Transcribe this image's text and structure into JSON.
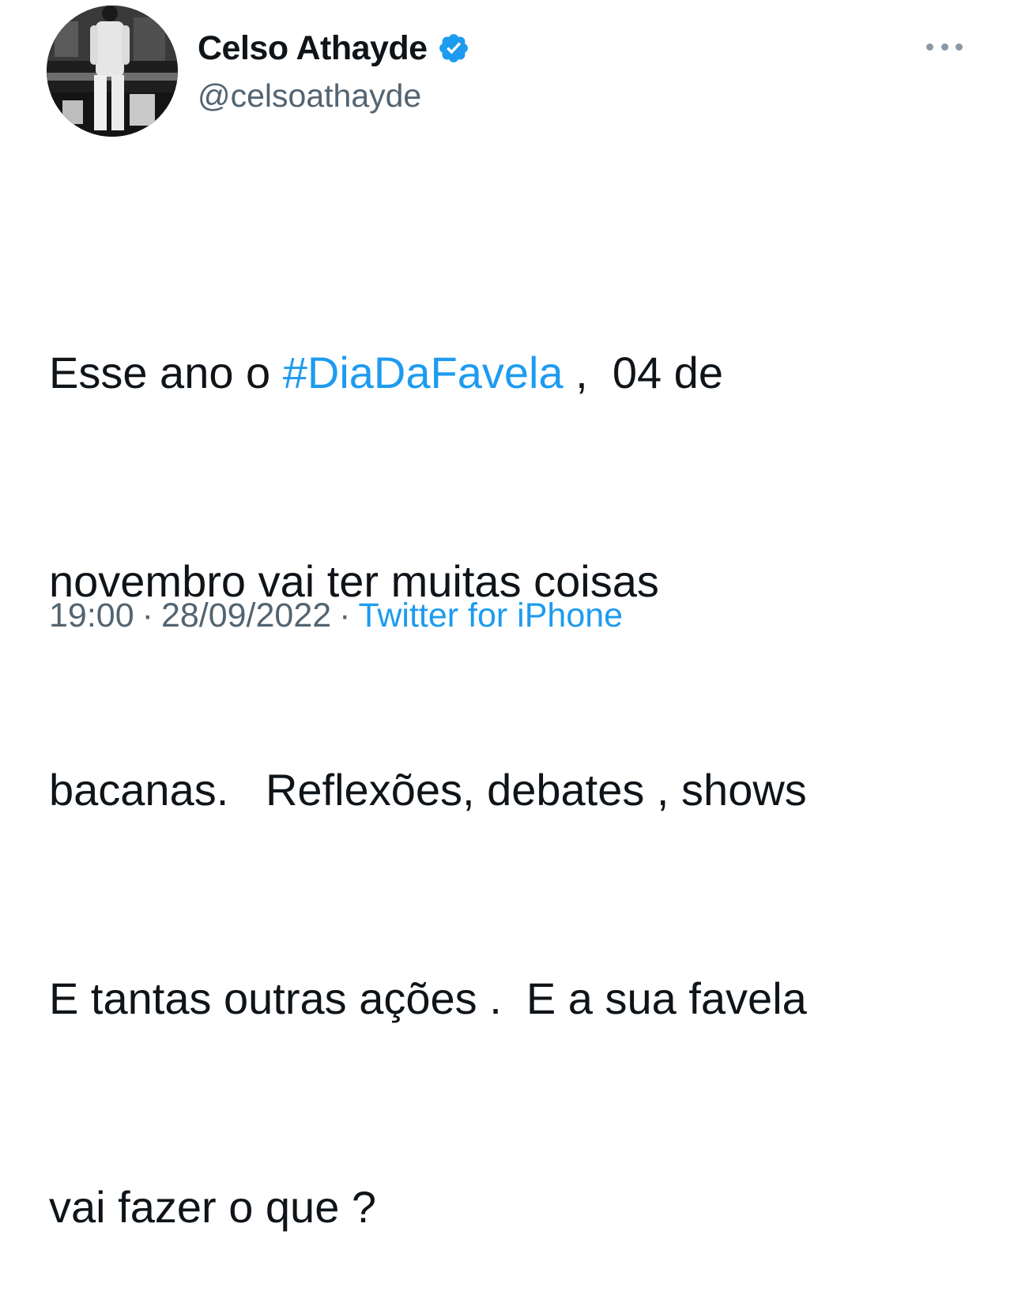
{
  "author": {
    "display_name": "Celso Athayde",
    "handle": "@celsoathayde",
    "verified_icon": "verified-badge-icon",
    "avatar_icon": "profile-photo"
  },
  "more_icon": "more-horizontal-icon",
  "tweet": {
    "line1_pre": "Esse ano o ",
    "hashtag": "#DiaDaFavela",
    "line1_post": " ,  04 de",
    "line2": "novembro vai ter muitas coisas",
    "line3": "bacanas.   Reflexões, debates , shows",
    "line4": "E tantas outras ações .  E a sua favela",
    "line5": "vai fazer o que ?"
  },
  "meta": {
    "time": "19:00",
    "separator": "·",
    "date": "28/09/2022",
    "source": "Twitter for iPhone"
  },
  "colors": {
    "link": "#1d9bf0",
    "secondary_text": "#536471",
    "primary_text": "#0f1419"
  }
}
